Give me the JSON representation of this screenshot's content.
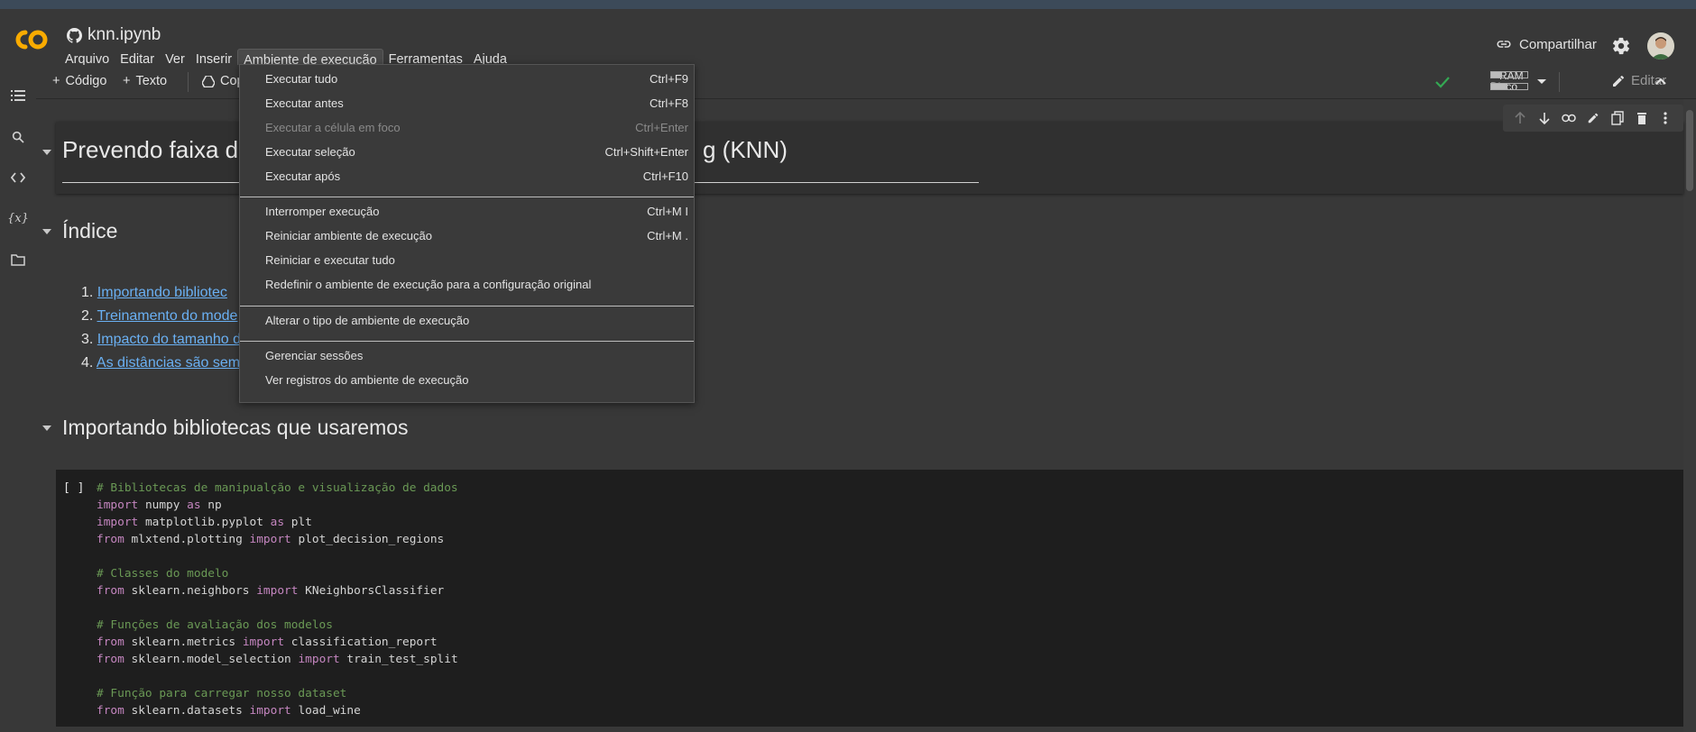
{
  "notebook": {
    "title": "knn.ipynb"
  },
  "menubar": {
    "items": [
      "Arquivo",
      "Editar",
      "Ver",
      "Inserir",
      "Ambiente de execução",
      "Ferramentas",
      "Ajuda"
    ]
  },
  "header": {
    "share_label": "Compartilhar"
  },
  "toolbar": {
    "code_label": "Código",
    "text_label": "Texto",
    "copy_label": "Cop",
    "ram_label": "RAM",
    "disk_label": "Disco",
    "edit_label": "Editar",
    "ram_fill": 0.3,
    "disk_fill": 0.45
  },
  "dropdown": {
    "items": [
      {
        "label": "Executar tudo",
        "shortcut": "Ctrl+F9",
        "disabled": false
      },
      {
        "label": "Executar antes",
        "shortcut": "Ctrl+F8",
        "disabled": false
      },
      {
        "label": "Executar a célula em foco",
        "shortcut": "Ctrl+Enter",
        "disabled": true
      },
      {
        "label": "Executar seleção",
        "shortcut": "Ctrl+Shift+Enter",
        "disabled": false
      },
      {
        "label": "Executar após",
        "shortcut": "Ctrl+F10",
        "disabled": false
      },
      {
        "label": "Interromper execução",
        "shortcut": "Ctrl+M I",
        "disabled": false
      },
      {
        "label": "Reiniciar ambiente de execução",
        "shortcut": "Ctrl+M .",
        "disabled": false
      },
      {
        "label": "Reiniciar e executar tudo",
        "shortcut": "",
        "disabled": false
      },
      {
        "label": "Redefinir o ambiente de execução para a configuração original",
        "shortcut": "",
        "disabled": false
      },
      {
        "label": "Alterar o tipo de ambiente de execução",
        "shortcut": "",
        "disabled": false
      },
      {
        "label": "Gerenciar sessões",
        "shortcut": "",
        "disabled": false
      },
      {
        "label": "Ver registros do ambiente de execução",
        "shortcut": "",
        "disabled": false
      }
    ]
  },
  "cells": {
    "title_left": "Prevendo faixa d",
    "title_right": "g (KNN)",
    "index_heading": "Índice",
    "toc": [
      {
        "num": "1.",
        "text": "Importando bibliotec"
      },
      {
        "num": "2.",
        "text": "Treinamento do mode"
      },
      {
        "num": "3.",
        "text": "Impacto do tamanho d"
      },
      {
        "num": "4.",
        "text": "As distâncias são sem"
      }
    ],
    "import_heading": "Importando bibliotecas que usaremos",
    "run_indicator": "[ ]"
  },
  "code": {
    "lines": [
      [
        {
          "t": "# Bibliotecas de manipualção e visualização de dados",
          "c": "cm"
        }
      ],
      [
        {
          "t": "import",
          "c": "kw"
        },
        {
          "t": " numpy ",
          "c": ""
        },
        {
          "t": "as",
          "c": "kw"
        },
        {
          "t": " np",
          "c": ""
        }
      ],
      [
        {
          "t": "import",
          "c": "kw"
        },
        {
          "t": " matplotlib.pyplot ",
          "c": ""
        },
        {
          "t": "as",
          "c": "kw"
        },
        {
          "t": " plt",
          "c": ""
        }
      ],
      [
        {
          "t": "from",
          "c": "kw"
        },
        {
          "t": " mlxtend.plotting ",
          "c": ""
        },
        {
          "t": "import",
          "c": "kw"
        },
        {
          "t": " plot_decision_regions",
          "c": ""
        }
      ],
      [],
      [
        {
          "t": "# Classes do modelo",
          "c": "cm"
        }
      ],
      [
        {
          "t": "from",
          "c": "kw"
        },
        {
          "t": " sklearn.neighbors ",
          "c": ""
        },
        {
          "t": "import",
          "c": "kw"
        },
        {
          "t": " KNeighborsClassifier",
          "c": ""
        }
      ],
      [],
      [
        {
          "t": "# Funções de avaliação dos modelos",
          "c": "cm"
        }
      ],
      [
        {
          "t": "from",
          "c": "kw"
        },
        {
          "t": " sklearn.metrics ",
          "c": ""
        },
        {
          "t": "import",
          "c": "kw"
        },
        {
          "t": " classification_report",
          "c": ""
        }
      ],
      [
        {
          "t": "from",
          "c": "kw"
        },
        {
          "t": " sklearn.model_selection ",
          "c": ""
        },
        {
          "t": "import",
          "c": "kw"
        },
        {
          "t": " train_test_split",
          "c": ""
        }
      ],
      [],
      [
        {
          "t": "# Função para carregar nosso dataset",
          "c": "cm"
        }
      ],
      [
        {
          "t": "from",
          "c": "kw"
        },
        {
          "t": " sklearn.datasets ",
          "c": ""
        },
        {
          "t": "import",
          "c": "kw"
        },
        {
          "t": " load_wine",
          "c": ""
        }
      ]
    ]
  },
  "colors": {
    "accent": "#f9ab00",
    "link": "#6ab0f3",
    "check": "#34a853"
  }
}
